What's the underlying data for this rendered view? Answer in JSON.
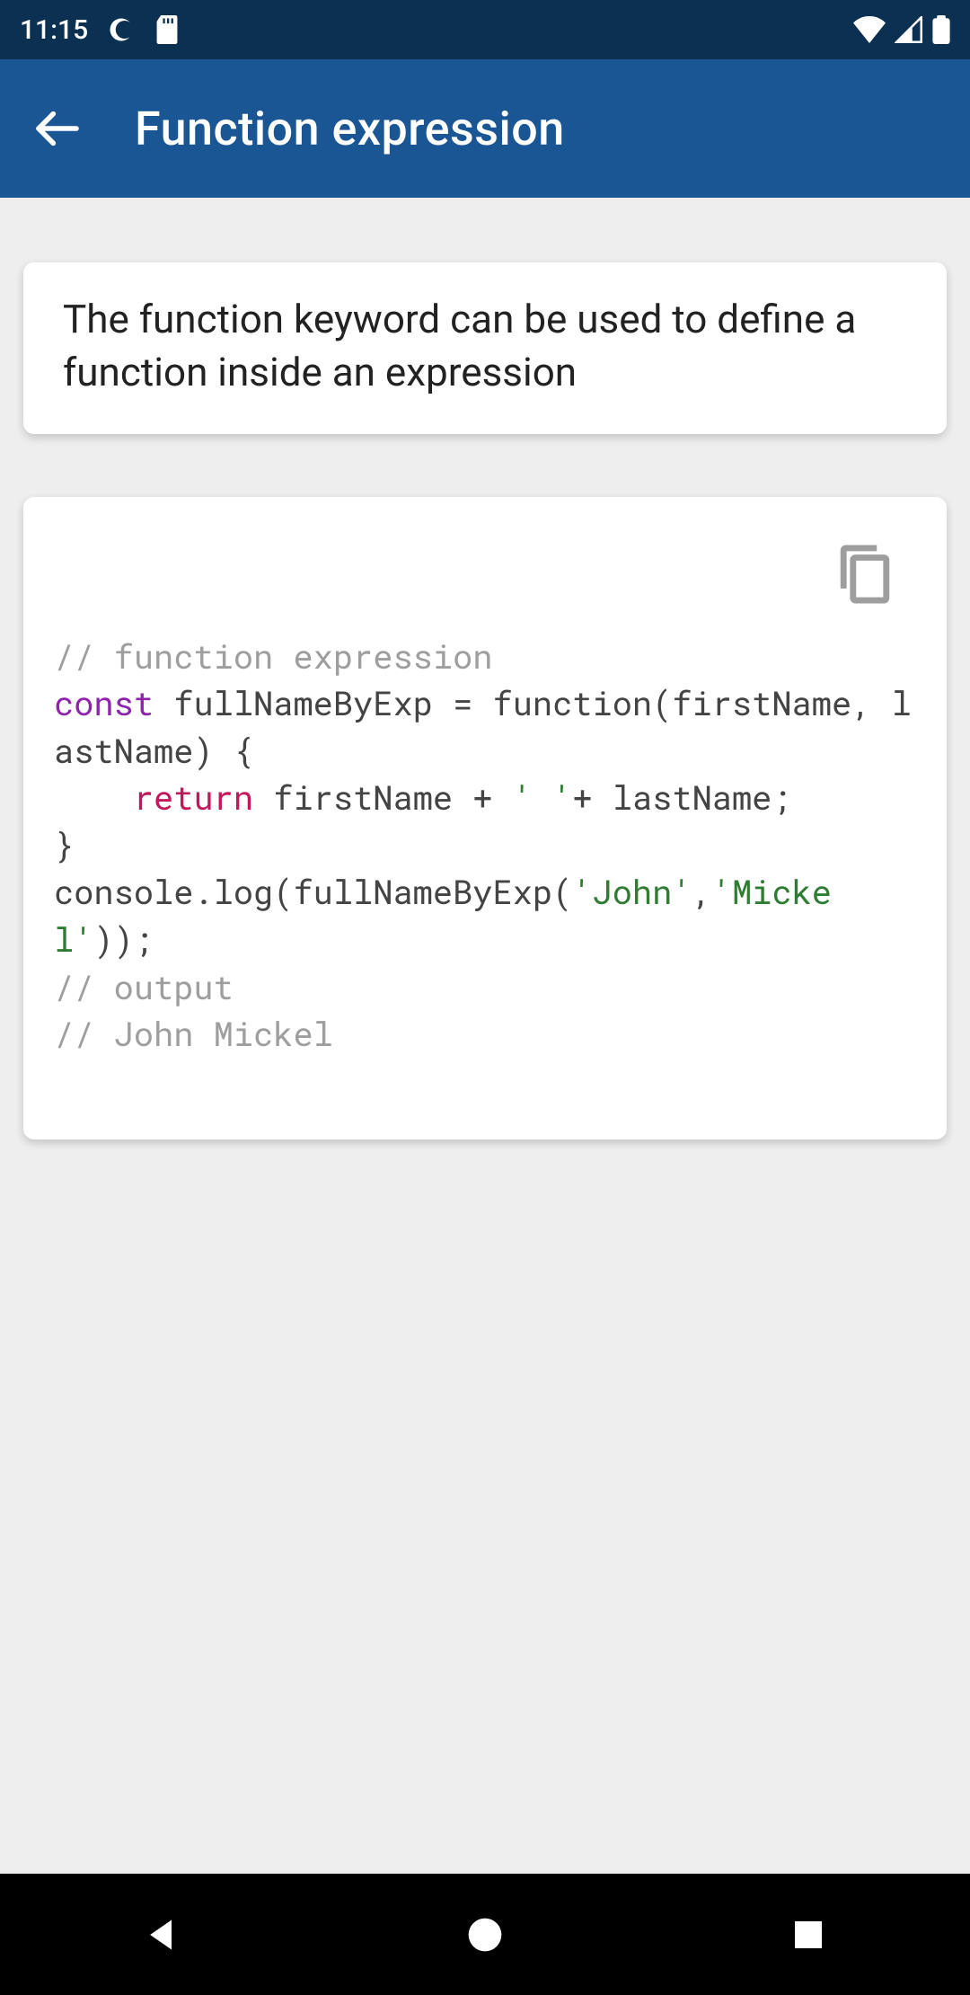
{
  "status": {
    "time": "11:15",
    "left_icons": [
      "moon-icon",
      "sd-card-icon"
    ],
    "right_icons": [
      "wifi-icon",
      "signal-icon",
      "battery-icon"
    ]
  },
  "appbar": {
    "title": "Function expression",
    "back": "Back"
  },
  "description": {
    "text": "The function keyword can be used to define a function inside an expression"
  },
  "code": {
    "copy_label": "Copy",
    "tokens": [
      {
        "t": "cmt",
        "v": "// function expression"
      },
      {
        "t": "nl"
      },
      {
        "t": "kw",
        "v": "const"
      },
      {
        "t": "txt",
        "v": " fullNameByExp = function(firstName, lastName) {"
      },
      {
        "t": "nl"
      },
      {
        "t": "txt",
        "v": "    "
      },
      {
        "t": "kw2",
        "v": "return"
      },
      {
        "t": "txt",
        "v": " firstName + "
      },
      {
        "t": "str",
        "v": "' '"
      },
      {
        "t": "txt",
        "v": "+ lastName;"
      },
      {
        "t": "nl"
      },
      {
        "t": "txt",
        "v": "}"
      },
      {
        "t": "nl"
      },
      {
        "t": "txt",
        "v": "console.log(fullNameByExp("
      },
      {
        "t": "str",
        "v": "'John'"
      },
      {
        "t": "txt",
        "v": ","
      },
      {
        "t": "str",
        "v": "'Mickel'"
      },
      {
        "t": "txt",
        "v": "));"
      },
      {
        "t": "nl"
      },
      {
        "t": "cmt",
        "v": "// output"
      },
      {
        "t": "nl"
      },
      {
        "t": "cmt",
        "v": "// John Mickel"
      }
    ]
  },
  "nav": {
    "back": "Back",
    "home": "Home",
    "recent": "Recent"
  }
}
